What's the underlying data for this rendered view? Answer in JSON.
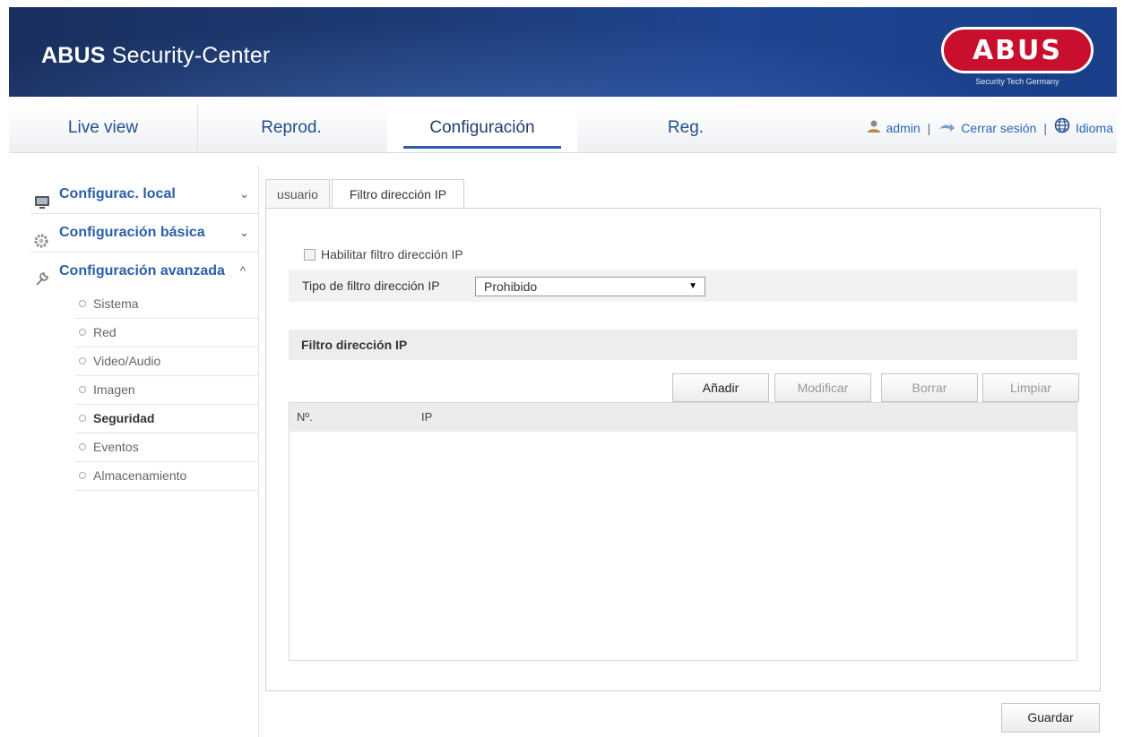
{
  "header": {
    "title_bold": "ABUS",
    "title_rest": " Security-Center",
    "logo_text": "ABUS",
    "logo_tagline": "Security Tech Germany"
  },
  "nav": {
    "tabs": [
      {
        "label": "Live view"
      },
      {
        "label": "Reprod."
      },
      {
        "label": "Configuración",
        "active": true
      },
      {
        "label": "Reg."
      }
    ],
    "user": "admin",
    "logout": "Cerrar sesión",
    "language": "Idioma",
    "separator": "|"
  },
  "sidebar": {
    "sections": [
      {
        "label": "Configurac. local",
        "icon": "monitor-icon",
        "chevron": "⌄"
      },
      {
        "label": "Configuración básica",
        "icon": "gear-icon",
        "chevron": "⌄"
      },
      {
        "label": "Configuración avanzada",
        "icon": "wrench-icon",
        "chevron": "^"
      }
    ],
    "items": [
      {
        "label": "Sistema"
      },
      {
        "label": "Red"
      },
      {
        "label": "Video/Audio"
      },
      {
        "label": "Imagen"
      },
      {
        "label": "Seguridad",
        "active": true
      },
      {
        "label": "Eventos"
      },
      {
        "label": "Almacenamiento"
      }
    ]
  },
  "content": {
    "tabs": [
      {
        "label": "usuario"
      },
      {
        "label": "Filtro dirección IP",
        "active": true
      }
    ],
    "enable_label": "Habilitar filtro dirección IP",
    "enable_checked": false,
    "type_label": "Tipo de filtro dirección IP",
    "type_value": "Prohibido",
    "list_title": "Filtro dirección IP",
    "buttons": {
      "add": "Añadir",
      "modify": "Modificar",
      "delete": "Borrar",
      "clear": "Limpiar"
    },
    "table": {
      "columns": [
        "Nº.",
        "IP"
      ],
      "rows": []
    },
    "save": "Guardar"
  }
}
